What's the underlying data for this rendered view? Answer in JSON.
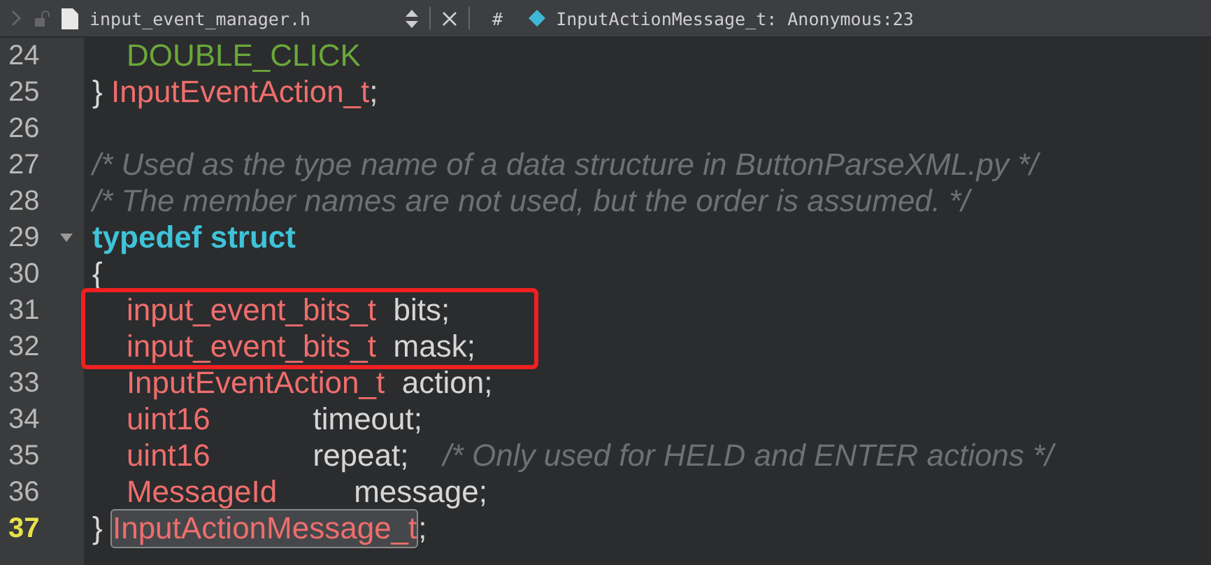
{
  "toolbar": {
    "file_name": "input_event_manager.h",
    "hash_label": "#",
    "symbol": "InputActionMessage_t: Anonymous:23"
  },
  "lines": [
    {
      "number": "24",
      "current": false,
      "foldable": false,
      "highlighted": false,
      "tokens": [
        {
          "kind": "constant",
          "text": "    DOUBLE_CLICK"
        }
      ]
    },
    {
      "number": "25",
      "current": false,
      "foldable": false,
      "highlighted": false,
      "tokens": [
        {
          "kind": "plain",
          "text": "} "
        },
        {
          "kind": "type",
          "text": "InputEventAction_t"
        },
        {
          "kind": "plain",
          "text": ";"
        }
      ]
    },
    {
      "number": "26",
      "current": false,
      "foldable": false,
      "highlighted": false
    },
    {
      "number": "27",
      "current": false,
      "foldable": false,
      "highlighted": false,
      "tokens": [
        {
          "kind": "comment",
          "text": "/* Used as the type name of a data structure in ButtonParseXML.py */"
        }
      ]
    },
    {
      "number": "28",
      "current": false,
      "foldable": false,
      "highlighted": false,
      "tokens": [
        {
          "kind": "comment",
          "text": "/* The member names are not used, but the order is assumed. */"
        }
      ]
    },
    {
      "number": "29",
      "current": false,
      "foldable": true,
      "highlighted": false,
      "tokens": [
        {
          "kind": "keyword",
          "text": "typedef struct"
        }
      ]
    },
    {
      "number": "30",
      "current": false,
      "foldable": false,
      "highlighted": false,
      "tokens": [
        {
          "kind": "plain",
          "text": "{"
        }
      ]
    },
    {
      "number": "31",
      "current": false,
      "foldable": false,
      "highlighted": true,
      "tokens": [
        {
          "kind": "type",
          "text": "    input_event_bits_t"
        },
        {
          "kind": "plain",
          "text": "  bits;"
        }
      ]
    },
    {
      "number": "32",
      "current": false,
      "foldable": false,
      "highlighted": true,
      "tokens": [
        {
          "kind": "type",
          "text": "    input_event_bits_t"
        },
        {
          "kind": "plain",
          "text": "  mask;"
        }
      ]
    },
    {
      "number": "33",
      "current": false,
      "foldable": false,
      "highlighted": false,
      "tokens": [
        {
          "kind": "type",
          "text": "    InputEventAction_t"
        },
        {
          "kind": "plain",
          "text": "  action;"
        }
      ]
    },
    {
      "number": "34",
      "current": false,
      "foldable": false,
      "highlighted": false,
      "tokens": [
        {
          "kind": "type",
          "text": "    uint16"
        },
        {
          "kind": "plain",
          "text": "            timeout;"
        }
      ]
    },
    {
      "number": "35",
      "current": false,
      "foldable": false,
      "highlighted": false,
      "tokens": [
        {
          "kind": "type",
          "text": "    uint16"
        },
        {
          "kind": "plain",
          "text": "            repeat;    "
        },
        {
          "kind": "comment",
          "text": "/* Only used for HELD and ENTER actions */"
        }
      ]
    },
    {
      "number": "36",
      "current": false,
      "foldable": false,
      "highlighted": false,
      "tokens": [
        {
          "kind": "type",
          "text": "    MessageId"
        },
        {
          "kind": "plain",
          "text": "         message;"
        }
      ]
    },
    {
      "number": "37",
      "current": true,
      "foldable": false,
      "highlighted": false,
      "tokens": [
        {
          "kind": "plain",
          "text": "} "
        },
        {
          "kind": "selected",
          "text": "InputActionMessage_t"
        },
        {
          "kind": "plain",
          "text": ";"
        }
      ]
    }
  ]
}
